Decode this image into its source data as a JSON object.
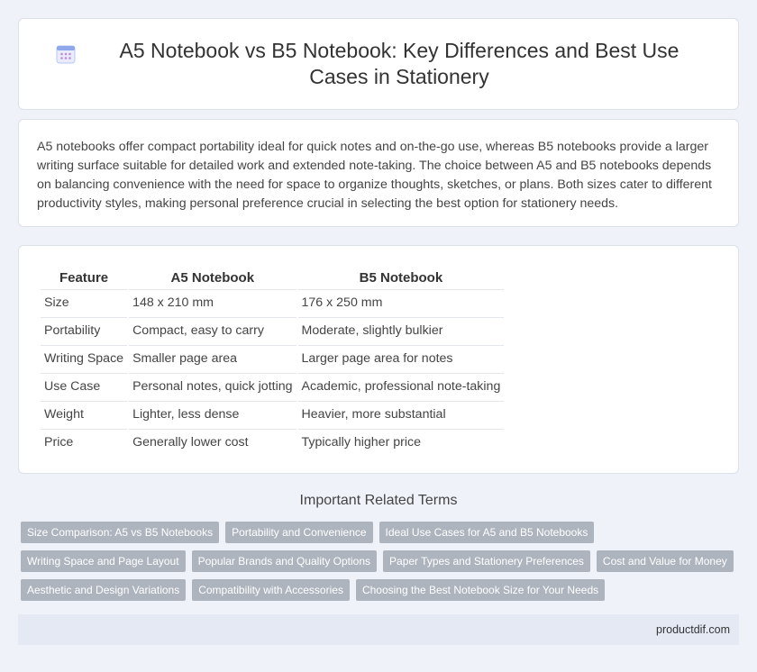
{
  "header": {
    "title": "A5 Notebook vs B5 Notebook: Key Differences and Best Use Cases in Stationery",
    "icon": "calendar-icon"
  },
  "intro": {
    "text": "A5 notebooks offer compact portability ideal for quick notes and on-the-go use, whereas B5 notebooks provide a larger writing surface suitable for detailed work and extended note-taking. The choice between A5 and B5 notebooks depends on balancing convenience with the need for space to organize thoughts, sketches, or plans. Both sizes cater to different productivity styles, making personal preference crucial in selecting the best option for stationery needs."
  },
  "table": {
    "headers": [
      "Feature",
      "A5 Notebook",
      "B5 Notebook"
    ],
    "rows": [
      [
        "Size",
        "148 x 210 mm",
        "176 x 250 mm"
      ],
      [
        "Portability",
        "Compact, easy to carry",
        "Moderate, slightly bulkier"
      ],
      [
        "Writing Space",
        "Smaller page area",
        "Larger page area for notes"
      ],
      [
        "Use Case",
        "Personal notes, quick jotting",
        "Academic, professional note-taking"
      ],
      [
        "Weight",
        "Lighter, less dense",
        "Heavier, more substantial"
      ],
      [
        "Price",
        "Generally lower cost",
        "Typically higher price"
      ]
    ]
  },
  "related": {
    "title": "Important Related Terms",
    "rows": [
      [
        "Size Comparison: A5 vs B5 Notebooks",
        "Portability and Convenience",
        "Ideal Use Cases for A5 and B5 Notebooks"
      ],
      [
        "Writing Space and Page Layout",
        "Popular Brands and Quality Options",
        "Paper Types and Stationery Preferences",
        "Cost and Value for Money"
      ],
      [
        "Aesthetic and Design Variations",
        "Compatibility with Accessories",
        "Choosing the Best Notebook Size for Your Needs"
      ]
    ]
  },
  "footer": {
    "site": "productdif.com"
  },
  "colors": {
    "background": "#eff2f8",
    "tag": "#aeb4be",
    "footer": "#e4e9f4",
    "icon_accent": "#8fa8ec"
  }
}
